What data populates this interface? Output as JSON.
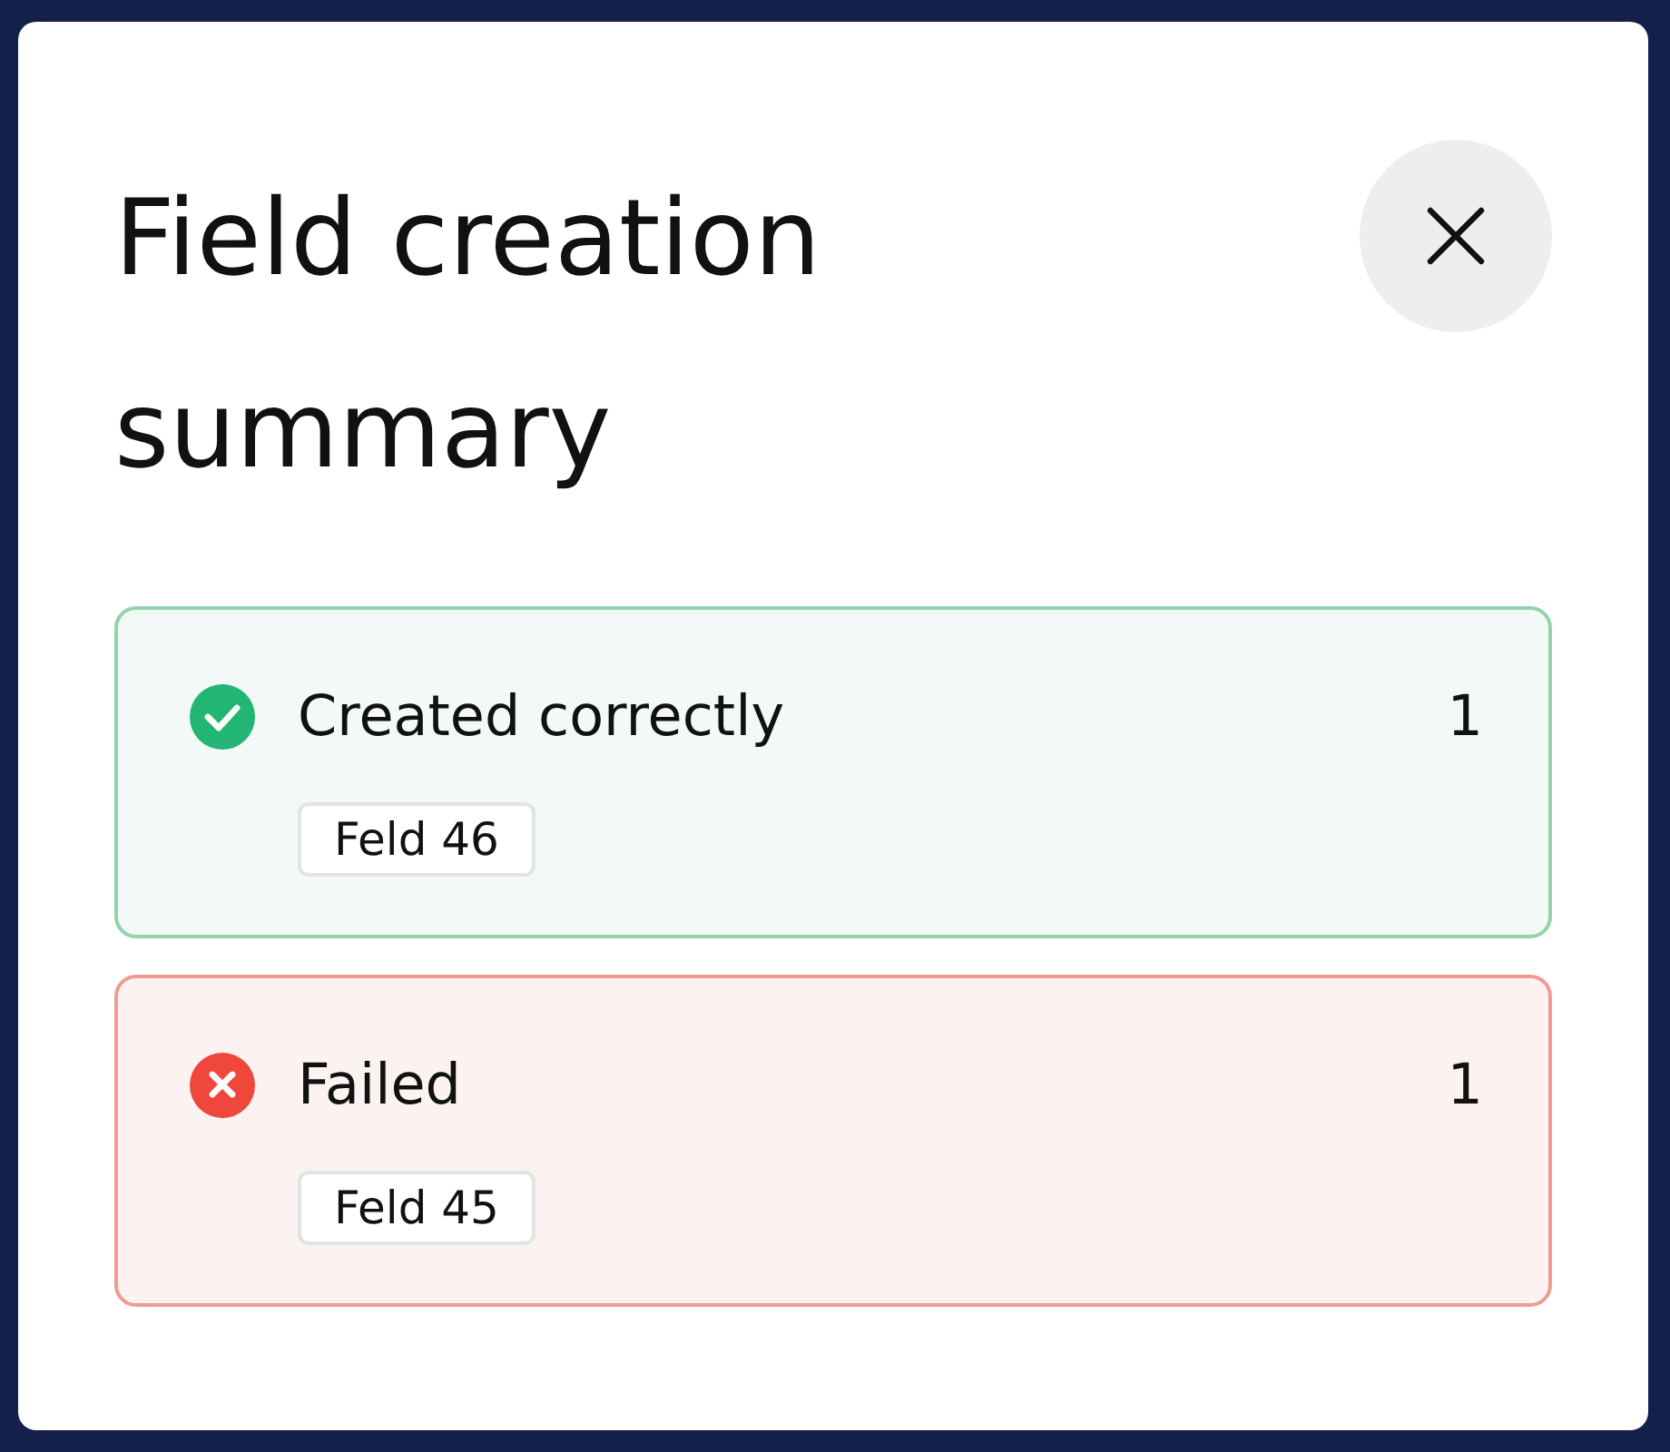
{
  "dialog": {
    "title": "Field creation summary",
    "groups": [
      {
        "kind": "success",
        "label": "Created correctly",
        "count": "1",
        "fields": [
          "Feld 46"
        ]
      },
      {
        "kind": "failure",
        "label": "Failed",
        "count": "1",
        "fields": [
          "Feld 45"
        ]
      }
    ]
  }
}
